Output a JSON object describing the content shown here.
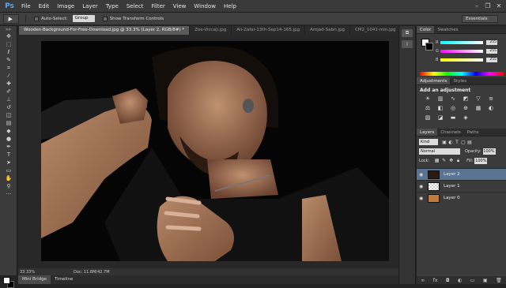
{
  "app": {
    "logo": "Ps"
  },
  "menu": [
    "File",
    "Edit",
    "Image",
    "Layer",
    "Type",
    "Select",
    "Filter",
    "View",
    "Window",
    "Help"
  ],
  "window_controls": [
    "–",
    "❐",
    "✕"
  ],
  "options_bar": {
    "auto_select_label": "Auto-Select:",
    "auto_select_value": "Group",
    "transform_label": "Show Transform Controls",
    "workspace": "Essentials"
  },
  "tabs": [
    {
      "label": "Wooden-Background-For-Free-Download.jpg @ 33.3% (Layer 2, RGB/8#) *",
      "active": true
    },
    {
      "label": "Zoe-Viccaji.jpg",
      "active": false
    },
    {
      "label": "Ali-Zafar-13th-Sep14-165.jpg",
      "active": false
    },
    {
      "label": "Amjad-Sabri.jpg",
      "active": false
    },
    {
      "label": "CM2_1041-min.jpg",
      "active": false
    }
  ],
  "status": {
    "zoom": "33.33%",
    "doc": "Doc: 11.8M/42.7M"
  },
  "bottom_tabs": [
    "Mini Bridge",
    "Timeline"
  ],
  "color_panel": {
    "tabs": [
      "Color",
      "Swatches"
    ],
    "sliders": [
      {
        "label": "R",
        "value": "255",
        "gradient": "linear-gradient(90deg,#00ffff,#ffffff)"
      },
      {
        "label": "G",
        "value": "255",
        "gradient": "linear-gradient(90deg,#ff00ff,#ffffff)"
      },
      {
        "label": "B",
        "value": "255",
        "gradient": "linear-gradient(90deg,#ffff00,#ffffff)"
      }
    ]
  },
  "adjustments_panel": {
    "tabs": [
      "Adjustments",
      "Styles"
    ],
    "title": "Add an adjustment"
  },
  "layers_panel": {
    "tabs": [
      "Layers",
      "Channels",
      "Paths"
    ],
    "kind": "Kind",
    "blend_mode": "Normal",
    "opacity_label": "Opacity:",
    "opacity": "100%",
    "lock_label": "Lock:",
    "fill_label": "Fill:",
    "fill": "100%",
    "layers": [
      {
        "name": "Layer 2",
        "selected": true,
        "thumb": "#2a1a12"
      },
      {
        "name": "Layer 1",
        "selected": false,
        "thumb": "checker"
      },
      {
        "name": "Layer 0",
        "selected": false,
        "thumb": "#c07a3a"
      }
    ]
  },
  "colors": {
    "accent_selected": "#5a7391",
    "ps_blue": "#4fa8ff"
  }
}
